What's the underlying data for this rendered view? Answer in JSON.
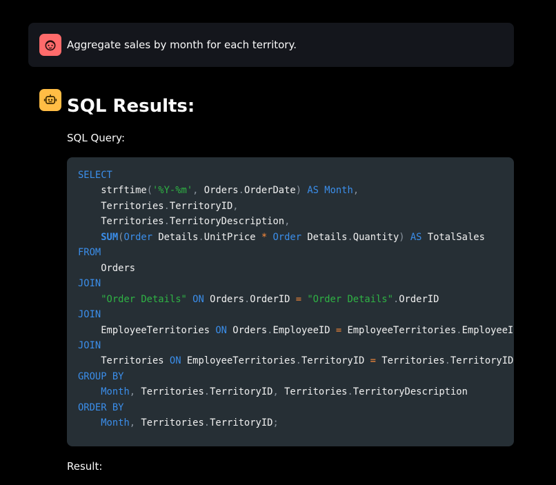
{
  "user_message": {
    "avatar_icon": "face-icon",
    "avatar_color": "#ff6b6b",
    "text": "Aggregate sales by month for each territory."
  },
  "assistant": {
    "avatar_icon": "robot-icon",
    "avatar_color": "#ffbd45",
    "title": "SQL Results:",
    "query_label": "SQL Query:",
    "result_label": "Result:"
  },
  "code": {
    "language": "sql",
    "colors": {
      "keyword": "#3b8eea",
      "string": "#2fb344",
      "operator": "#ff8c3a",
      "punctuation": "#8b949e",
      "identifier": "#f0f0f0",
      "background": "#262f35"
    },
    "lines": [
      [
        [
          "kw",
          "SELECT"
        ]
      ],
      [
        [
          "id",
          "    strftime"
        ],
        [
          "pn",
          "("
        ],
        [
          "str",
          "'%Y-%m'"
        ],
        [
          "pn",
          ","
        ],
        [
          "id",
          " Orders"
        ],
        [
          "pn",
          "."
        ],
        [
          "id",
          "OrderDate"
        ],
        [
          "pn",
          ")"
        ],
        [
          "id",
          " "
        ],
        [
          "kw",
          "AS"
        ],
        [
          "id",
          " "
        ],
        [
          "kw",
          "Month"
        ],
        [
          "pn",
          ","
        ]
      ],
      [
        [
          "id",
          "    Territories"
        ],
        [
          "pn",
          "."
        ],
        [
          "id",
          "TerritoryID"
        ],
        [
          "pn",
          ","
        ]
      ],
      [
        [
          "id",
          "    Territories"
        ],
        [
          "pn",
          "."
        ],
        [
          "id",
          "TerritoryDescription"
        ],
        [
          "pn",
          ","
        ]
      ],
      [
        [
          "id",
          "    "
        ],
        [
          "kwb",
          "SUM"
        ],
        [
          "pn",
          "("
        ],
        [
          "kw",
          "Order"
        ],
        [
          "id",
          " Details"
        ],
        [
          "pn",
          "."
        ],
        [
          "id",
          "UnitPrice "
        ],
        [
          "op",
          "*"
        ],
        [
          "id",
          " "
        ],
        [
          "kw",
          "Order"
        ],
        [
          "id",
          " Details"
        ],
        [
          "pn",
          "."
        ],
        [
          "id",
          "Quantity"
        ],
        [
          "pn",
          ")"
        ],
        [
          "id",
          " "
        ],
        [
          "kw",
          "AS"
        ],
        [
          "id",
          " TotalSales"
        ]
      ],
      [
        [
          "kw",
          "FROM"
        ]
      ],
      [
        [
          "id",
          "    Orders"
        ]
      ],
      [
        [
          "kw",
          "JOIN"
        ]
      ],
      [
        [
          "id",
          "    "
        ],
        [
          "str",
          "\"Order Details\""
        ],
        [
          "id",
          " "
        ],
        [
          "kw",
          "ON"
        ],
        [
          "id",
          " Orders"
        ],
        [
          "pn",
          "."
        ],
        [
          "id",
          "OrderID "
        ],
        [
          "op",
          "="
        ],
        [
          "id",
          " "
        ],
        [
          "str",
          "\"Order Details\""
        ],
        [
          "pn",
          "."
        ],
        [
          "id",
          "OrderID"
        ]
      ],
      [
        [
          "kw",
          "JOIN"
        ]
      ],
      [
        [
          "id",
          "    EmployeeTerritories "
        ],
        [
          "kw",
          "ON"
        ],
        [
          "id",
          " Orders"
        ],
        [
          "pn",
          "."
        ],
        [
          "id",
          "EmployeeID "
        ],
        [
          "op",
          "="
        ],
        [
          "id",
          " EmployeeTerritories"
        ],
        [
          "pn",
          "."
        ],
        [
          "id",
          "EmployeeID"
        ]
      ],
      [
        [
          "kw",
          "JOIN"
        ]
      ],
      [
        [
          "id",
          "    Territories "
        ],
        [
          "kw",
          "ON"
        ],
        [
          "id",
          " EmployeeTerritories"
        ],
        [
          "pn",
          "."
        ],
        [
          "id",
          "TerritoryID "
        ],
        [
          "op",
          "="
        ],
        [
          "id",
          " Territories"
        ],
        [
          "pn",
          "."
        ],
        [
          "id",
          "TerritoryID"
        ]
      ],
      [
        [
          "kw",
          "GROUP BY"
        ]
      ],
      [
        [
          "id",
          "    "
        ],
        [
          "kw",
          "Month"
        ],
        [
          "pn",
          ","
        ],
        [
          "id",
          " Territories"
        ],
        [
          "pn",
          "."
        ],
        [
          "id",
          "TerritoryID"
        ],
        [
          "pn",
          ","
        ],
        [
          "id",
          " Territories"
        ],
        [
          "pn",
          "."
        ],
        [
          "id",
          "TerritoryDescription"
        ]
      ],
      [
        [
          "kw",
          "ORDER BY"
        ]
      ],
      [
        [
          "id",
          "    "
        ],
        [
          "kw",
          "Month"
        ],
        [
          "pn",
          ","
        ],
        [
          "id",
          " Territories"
        ],
        [
          "pn",
          "."
        ],
        [
          "id",
          "TerritoryID"
        ],
        [
          "pn",
          ";"
        ]
      ]
    ]
  }
}
